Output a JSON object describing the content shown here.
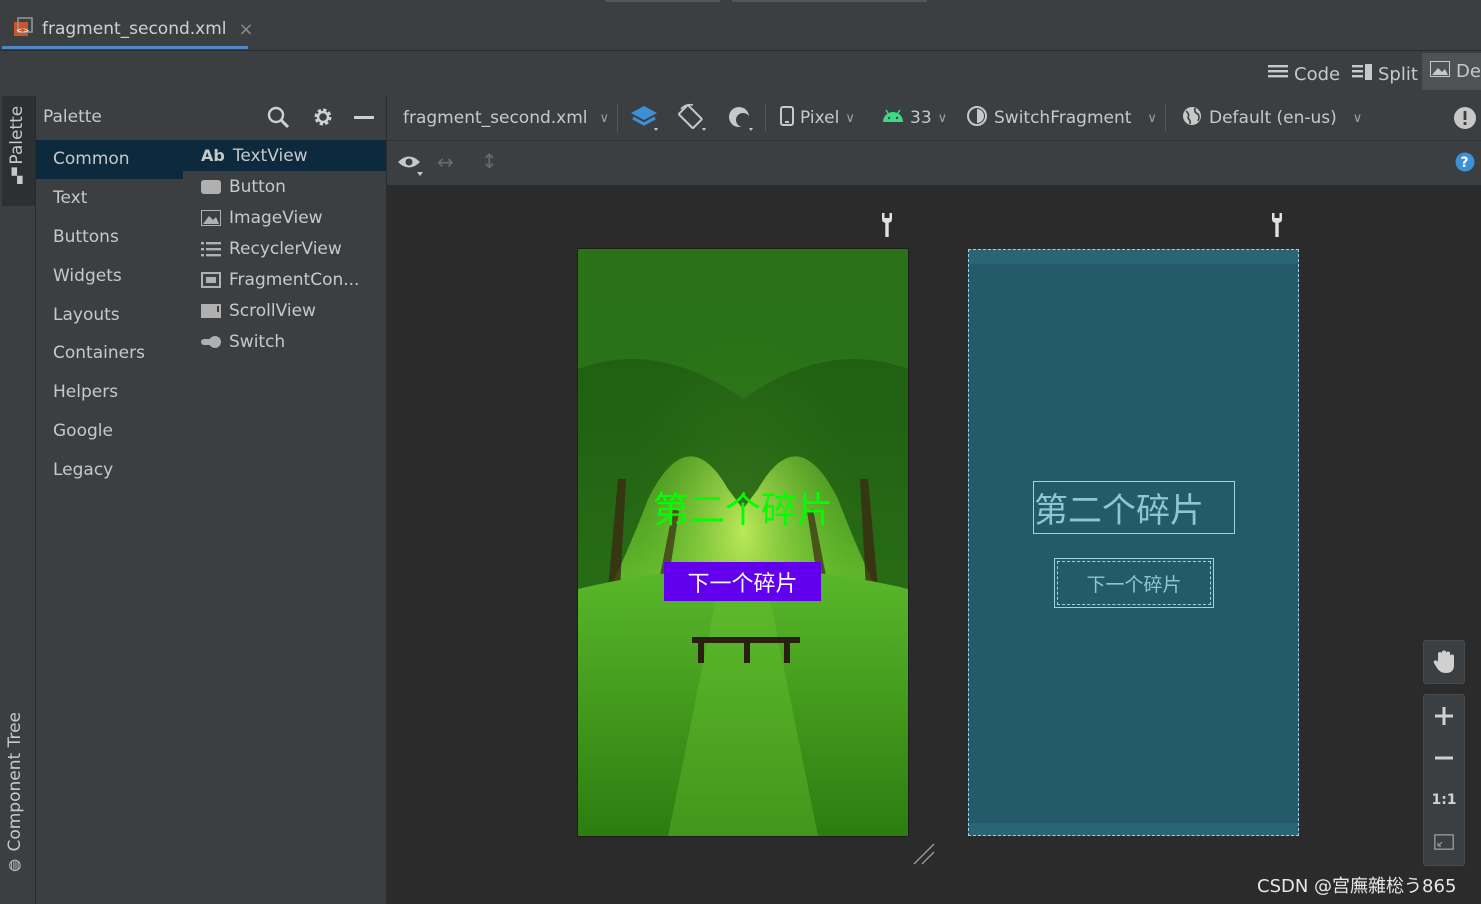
{
  "editor_tab": {
    "title": "fragment_second.xml",
    "close": "×"
  },
  "view_modes": [
    {
      "label": "Code"
    },
    {
      "label": "Split"
    },
    {
      "label": "De"
    }
  ],
  "left_strip": {
    "palette_tab": "Palette",
    "component_tree_tab": "Component Tree"
  },
  "palette": {
    "title": "Palette",
    "categories": [
      "Common",
      "Text",
      "Buttons",
      "Widgets",
      "Layouts",
      "Containers",
      "Helpers",
      "Google",
      "Legacy"
    ],
    "items": [
      {
        "label": "TextView",
        "icon": "textview-icon",
        "icon_text": "Ab"
      },
      {
        "label": "Button",
        "icon": "button-icon"
      },
      {
        "label": "ImageView",
        "icon": "imageview-icon"
      },
      {
        "label": "RecyclerView",
        "icon": "list-icon"
      },
      {
        "label": "FragmentCon...",
        "icon": "fragment-icon"
      },
      {
        "label": "ScrollView",
        "icon": "scrollview-icon"
      },
      {
        "label": "Switch",
        "icon": "switch-icon"
      }
    ]
  },
  "toolbar": {
    "file": "fragment_second.xml",
    "device": "Pixel",
    "api": "33",
    "theme": "SwitchFragment",
    "locale": "Default (en-us)"
  },
  "preview": {
    "title_text": "第二个碎片",
    "button_text": "下一个碎片",
    "title_color": "#00ff00",
    "button_color": "#6200ee"
  },
  "blueprint": {
    "title_text": "第二个碎片",
    "button_text": "下一个碎片"
  },
  "zoom": {
    "one_to_one": "1:1"
  },
  "watermark": "CSDN @宫廡雜棇う865",
  "colors": {
    "accent": "#4a88c7",
    "selection": "#0d293e",
    "blueprint": "#235b6a"
  }
}
